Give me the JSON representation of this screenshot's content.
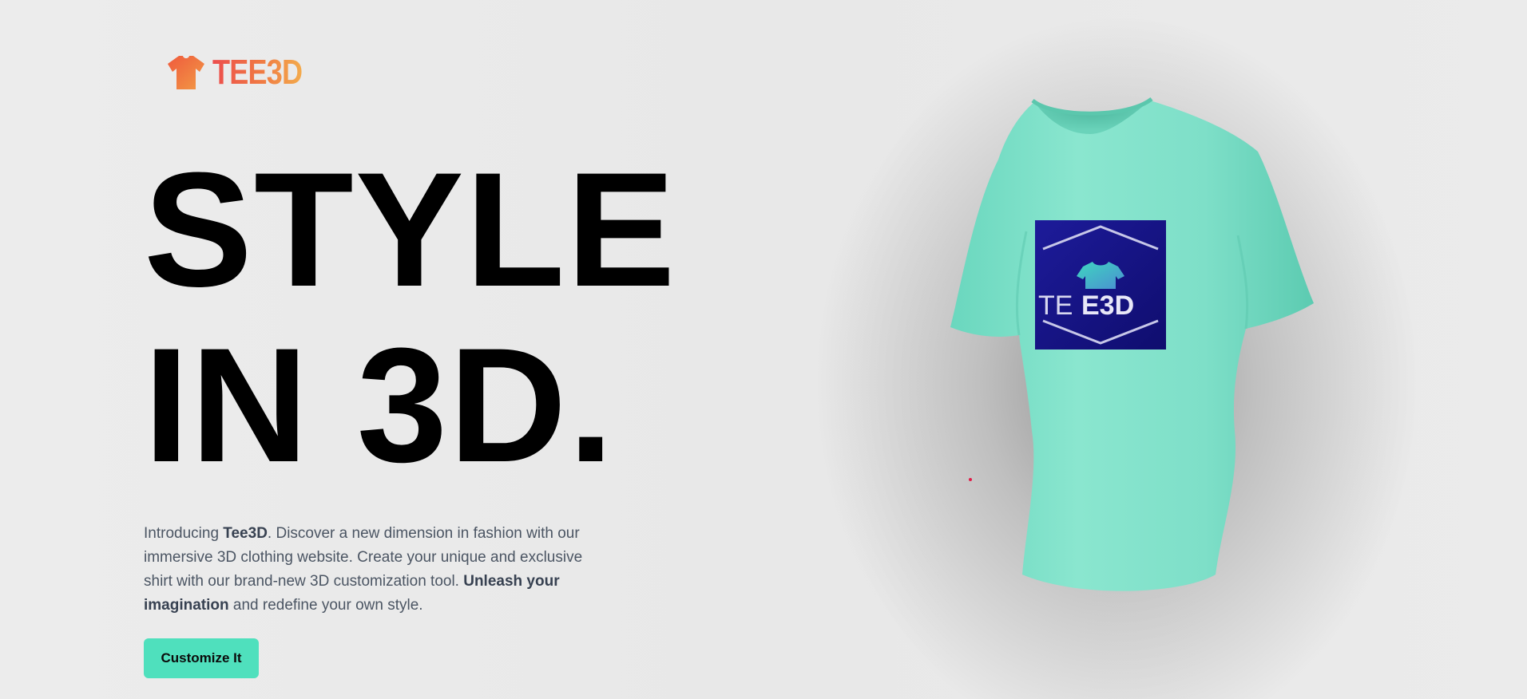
{
  "brand": {
    "name": "TEE3D",
    "logo_icon": "tshirt-icon",
    "gradient": [
      "#ec4d4d",
      "#f3ab4c"
    ]
  },
  "hero": {
    "headline_line1": "STYLE",
    "headline_line2": "IN 3D.",
    "intro_part1": "Introducing ",
    "intro_bold1": "Tee3D",
    "intro_part2": ". Discover a new dimension in fashion with our immersive 3D clothing website. Create your unique and exclusive shirt with our brand-new 3D customization tool. ",
    "intro_bold2": "Unleash your imagination",
    "intro_part3": " and redefine your own style.",
    "cta_label": "Customize It"
  },
  "shirt": {
    "color": "#7fe0c8",
    "decal_bg": "#14127f",
    "decal_text_light": "TE",
    "decal_text_bold": "E3D"
  },
  "colors": {
    "accent": "#4fe0bd",
    "text_muted": "#4b5563",
    "headline": "#000000"
  }
}
